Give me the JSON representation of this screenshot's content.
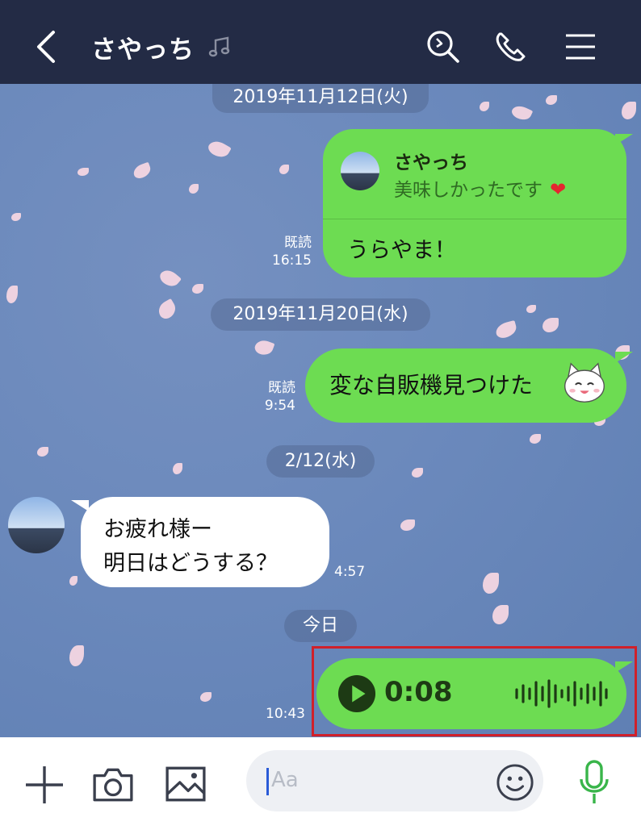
{
  "header": {
    "title": "さやっち"
  },
  "dates": [
    "2019年11月12日(火)",
    "2019年11月20日(水)",
    "2/12(水)",
    "今日"
  ],
  "messages": {
    "m1": {
      "reply_name": "さやっち",
      "reply_text": "美味しかったです",
      "text": "うらやま！",
      "read": "既読",
      "time": "16:15"
    },
    "m2": {
      "text": "変な自販機見つけた",
      "read": "既読",
      "time": "9:54"
    },
    "m3": {
      "line1": "お疲れ様ー",
      "line2": "明日はどうする？",
      "time": "4:57"
    },
    "m4": {
      "duration": "0:08",
      "time": "10:43"
    }
  },
  "input": {
    "placeholder": "Aa"
  },
  "colors": {
    "header_bg": "#232b45",
    "bubble_green": "#6ddc52",
    "highlight": "#d0202a",
    "mic": "#39b54a"
  },
  "icons": [
    "back-arrow-icon",
    "music-note-icon",
    "search-icon",
    "phone-icon",
    "menu-icon",
    "plus-icon",
    "camera-icon",
    "image-icon",
    "emoji-icon",
    "mic-icon",
    "play-icon",
    "waveform-icon",
    "heart-icon",
    "cat-face-icon"
  ]
}
